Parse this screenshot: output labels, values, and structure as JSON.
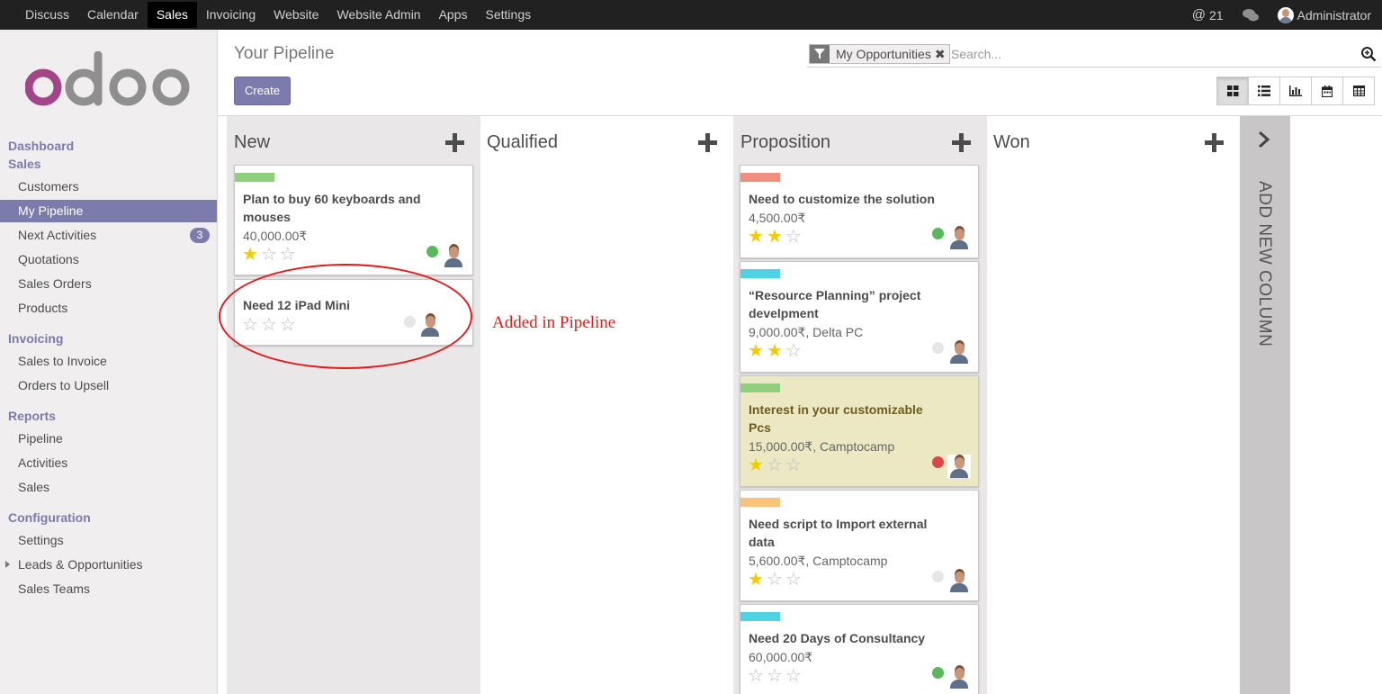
{
  "topnav": {
    "menu": [
      "Discuss",
      "Calendar",
      "Sales",
      "Invoicing",
      "Website",
      "Website Admin",
      "Apps",
      "Settings"
    ],
    "active": "Sales",
    "mentions": "21",
    "mention_icon": "at-icon",
    "chat_icon": "chat-bubbles-icon",
    "user": "Administrator"
  },
  "sidebar": {
    "logo": "odoo",
    "sections": {
      "dashboard": "Dashboard",
      "sales": "Sales",
      "invoicing": "Invoicing",
      "reports": "Reports",
      "configuration": "Configuration"
    },
    "items": {
      "customers": "Customers",
      "my_pipeline": "My Pipeline",
      "next_activities": "Next Activities",
      "next_activities_count": "3",
      "quotations": "Quotations",
      "sales_orders": "Sales Orders",
      "products": "Products",
      "sales_to_invoice": "Sales to Invoice",
      "orders_to_upsell": "Orders to Upsell",
      "pipeline": "Pipeline",
      "activities": "Activities",
      "sales": "Sales",
      "settings": "Settings",
      "leads_opportunities": "Leads & Opportunities",
      "sales_teams": "Sales Teams"
    }
  },
  "control": {
    "breadcrumb": "Your Pipeline",
    "create_label": "Create",
    "facet_label": "My Opportunities",
    "facet_remove": "✖",
    "search_placeholder": "Search...",
    "views": [
      "kanban-view-icon",
      "list-view-icon",
      "graph-view-icon",
      "calendar-view-icon",
      "pivot-view-icon"
    ],
    "active_view": "kanban-view-icon"
  },
  "kanban": {
    "columns": [
      {
        "title": "New",
        "cards": [
          {
            "title": "Plan to buy 60 keyboards and mouses",
            "amount": "40,000.00₹",
            "stars": 1,
            "tag_color": "#8fd07c",
            "state_color": "#59b95a"
          },
          {
            "title": "Need 12 iPad Mini",
            "amount": "",
            "stars": 0,
            "tag_color": "",
            "state_color": "#e6e6e6"
          }
        ]
      },
      {
        "title": "Qualified",
        "cards": []
      },
      {
        "title": "Proposition",
        "cards": [
          {
            "title": "Need to customize the solution",
            "amount": "4,500.00₹",
            "stars": 2,
            "tag_color": "#f08f80",
            "state_color": "#59b95a"
          },
          {
            "title": "“Resource Planning” project develpment",
            "amount": "9,000.00₹, Delta PC",
            "stars": 2,
            "tag_color": "#4fd2e4",
            "state_color": "#e6e6e6"
          },
          {
            "title": "Interest in your customizable Pcs",
            "amount": "15,000.00₹, Camptocamp",
            "stars": 1,
            "tag_color": "#8fd07c",
            "state_color": "#dc4848"
          },
          {
            "title": "Need script to Import external data",
            "amount": "5,600.00₹, Camptocamp",
            "stars": 1,
            "tag_color": "#f9c27d",
            "state_color": "#e6e6e6"
          },
          {
            "title": "Need 20 Days of Consultancy",
            "amount": "60,000.00₹",
            "stars": 0,
            "tag_color": "#4fd2e4",
            "state_color": "#59b95a"
          }
        ]
      },
      {
        "title": "Won",
        "cards": []
      }
    ],
    "add_column": "ADD NEW COLUMN"
  },
  "annotation": "Added in Pipeline",
  "colors": {
    "brand": "#7c7bad",
    "topbar": "#212121",
    "annotation": "#e41a1a"
  }
}
